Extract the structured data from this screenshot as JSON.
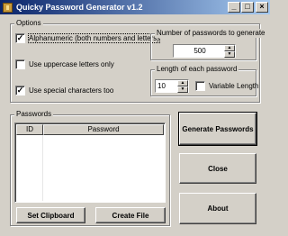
{
  "window": {
    "title": "Quicky Password Generator  v1.2",
    "buttons": {
      "minimize": "_",
      "maximize": "□",
      "close": "×"
    }
  },
  "options": {
    "group_label": "Options",
    "alphanumeric": {
      "label": "Alphanumeric (both numbers and letters)",
      "checked": true,
      "mark": "✓"
    },
    "uppercase": {
      "label": "Use uppercase letters only",
      "checked": false,
      "mark": ""
    },
    "special": {
      "label": "Use special characters too",
      "checked": true,
      "mark": "✓"
    }
  },
  "count": {
    "group_label": "Number of passwords to generate",
    "value": "500"
  },
  "length": {
    "group_label": "Length of each password",
    "value": "10",
    "variable_label": "Variable Length",
    "variable_checked": false,
    "variable_mark": ""
  },
  "passwords": {
    "group_label": "Passwords",
    "columns": [
      "ID",
      "Password"
    ]
  },
  "buttons": {
    "set_clipboard": "Set Clipboard",
    "create_file": "Create File",
    "generate": "Generate Passwords",
    "close": "Close",
    "about": "About"
  },
  "spin_arrows": {
    "up": "▲",
    "down": "▼"
  }
}
